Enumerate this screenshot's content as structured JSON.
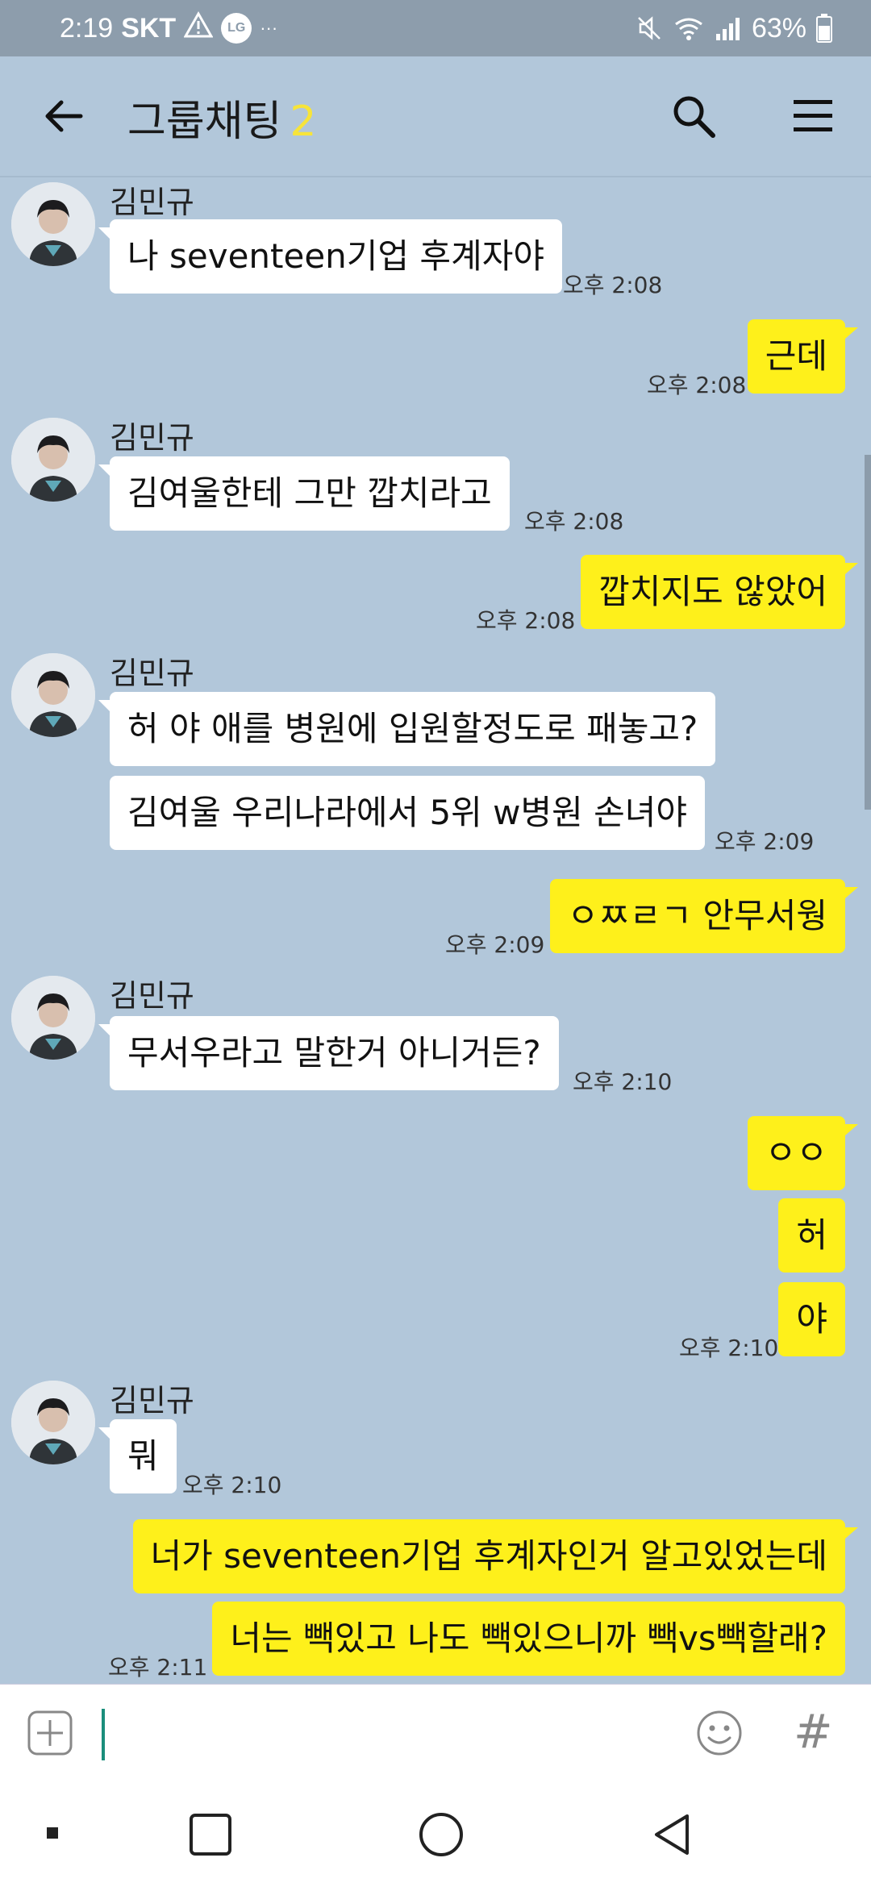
{
  "status_bar": {
    "time": "2:19",
    "carrier": "SKT",
    "lg_badge": "LG",
    "more": "···",
    "battery": "63%"
  },
  "header": {
    "title": "그룹채팅",
    "member_count": "2"
  },
  "messages": {
    "g1": {
      "sender": "김민규",
      "m1": "나  seventeen기업 후계자야",
      "time": "오후 2:08"
    },
    "o1": {
      "m1": "근데",
      "time": "오후 2:08"
    },
    "g2": {
      "sender": "김민규",
      "m1": "김여울한테 그만 깝치라고",
      "time": "오후 2:08"
    },
    "o2": {
      "m1": "깝치지도 않았어",
      "time": "오후 2:08"
    },
    "g3": {
      "sender": "김민규",
      "m1": "허 야 애를 병원에 입원할정도로 패놓고?",
      "m2": "김여울 우리나라에서 5위 w병원 손녀야",
      "time": "오후 2:09"
    },
    "o3": {
      "m1": "ㅇㅉㄹㄱ 안무서웡",
      "time": "오후 2:09"
    },
    "g4": {
      "sender": "김민규",
      "m1": "무서우라고 말한거 아니거든?",
      "time": "오후 2:10"
    },
    "o4": {
      "m1": "ㅇㅇ",
      "m2": "허",
      "m3": "야",
      "time": "오후 2:10"
    },
    "g5": {
      "sender": "김민규",
      "m1": "뭐",
      "time": "오후 2:10"
    },
    "o5": {
      "m1": "너가 seventeen기업 후계자인거 알고있었는데",
      "m2": "너는 빽있고 나도 빽있으니까 빽vs빽할래?",
      "time": "오후 2:11"
    }
  },
  "input": {
    "hash": "#"
  },
  "colors": {
    "chat_bg": "#b2c7da",
    "my_bubble": "#fef01b",
    "other_bubble": "#ffffff",
    "count_accent": "#f7e43a"
  }
}
